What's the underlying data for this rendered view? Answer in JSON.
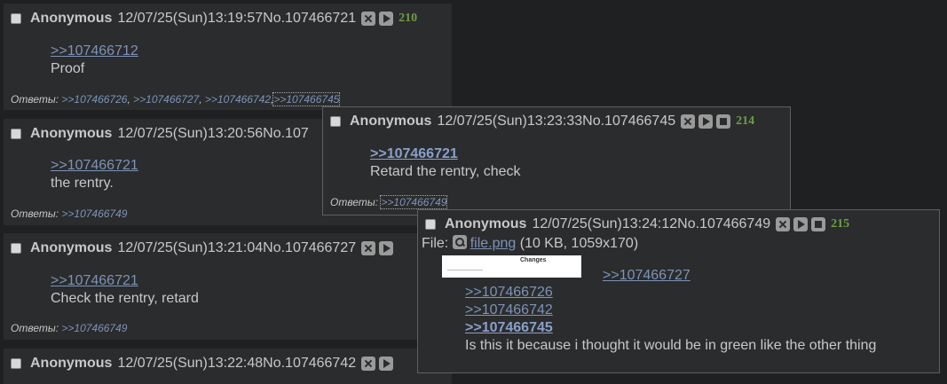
{
  "posts": [
    {
      "name": "Anonymous",
      "date": "12/07/25(Sun)13:19:57",
      "num": "No.107466721",
      "count": "210",
      "lines": [
        ">>107466712",
        "Proof"
      ],
      "replies_label": "Ответы:",
      "replies": [
        ">>107466726",
        ">>107466727",
        ">>107466742",
        ">>107466745"
      ]
    },
    {
      "name": "Anonymous",
      "date": "12/07/25(Sun)13:20:56",
      "num": "No.107",
      "lines": [
        ">>107466721",
        "the rentry."
      ],
      "replies_label": "Ответы:",
      "replies": [
        ">>107466749"
      ]
    },
    {
      "name": "Anonymous",
      "date": "12/07/25(Sun)13:21:04",
      "num": "No.107466727",
      "lines": [
        ">>107466721",
        "Check the rentry, retard"
      ],
      "replies_label": "Ответы:",
      "replies": [
        ">>107466749"
      ]
    },
    {
      "name": "Anonymous",
      "date": "12/07/25(Sun)13:22:48",
      "num": "No.107466742"
    }
  ],
  "popup1": {
    "name": "Anonymous",
    "date": "12/07/25(Sun)13:23:33",
    "num": "No.107466745",
    "count": "214",
    "lines": [
      ">>107466721",
      "Retard the rentry, check"
    ],
    "replies_label": "Ответы:",
    "replies": [
      ">>107466749"
    ]
  },
  "popup2": {
    "name": "Anonymous",
    "date": "12/07/25(Sun)13:24:12",
    "num": "No.107466749",
    "count": "215",
    "file_label": "File:",
    "file_name": "file.png",
    "file_info": "(10 KB, 1059x170)",
    "thumb_title": "Changes",
    "side_link": ">>107466727",
    "lines": [
      ">>107466726",
      ">>107466742",
      ">>107466745",
      "Is this it because i thought it would be in green like the other thing"
    ]
  },
  "icons": {
    "hide": "close-icon",
    "play": "play-icon",
    "stop": "stop-icon",
    "file": "magnifier-icon"
  }
}
